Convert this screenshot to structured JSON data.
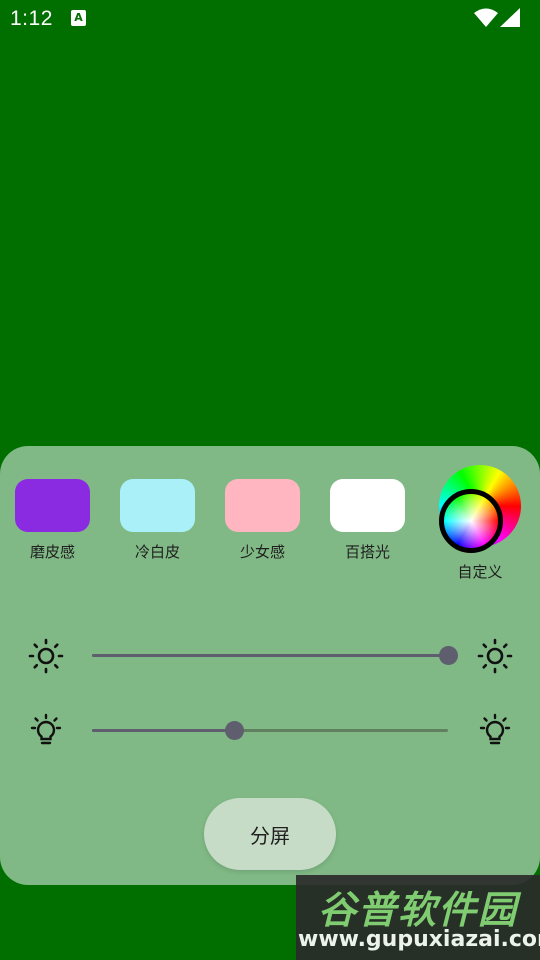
{
  "status_bar": {
    "time": "1:12",
    "notification_icon": "A"
  },
  "colors": {
    "background": "#006f00",
    "panel": "#80b985",
    "slider": "#5e5e6e"
  },
  "presets": [
    {
      "label": "磨皮感",
      "color": "#8a2be2"
    },
    {
      "label": "冷白皮",
      "color": "#aaf0f8"
    },
    {
      "label": "少女感",
      "color": "#ffb6c1"
    },
    {
      "label": "百搭光",
      "color": "#ffffff"
    }
  ],
  "custom": {
    "label": "自定义",
    "icon": "color-wheel-icon"
  },
  "sliders": [
    {
      "name": "brightness",
      "icon": "brightness-icon",
      "value_percent": 100
    },
    {
      "name": "light-temperature",
      "icon": "lightbulb-icon",
      "value_percent": 40
    }
  ],
  "split_button": {
    "label": "分屏"
  },
  "watermark": {
    "logo": "谷普软件园",
    "url": "www.gupuxiazai.com"
  }
}
